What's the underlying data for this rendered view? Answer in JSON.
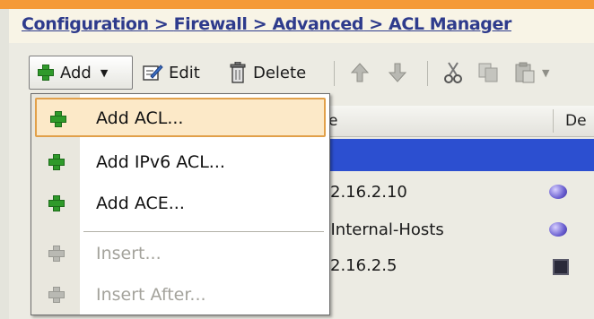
{
  "breadcrumb": {
    "configuration": "Configuration",
    "sep1": " > ",
    "firewall": "Firewall",
    "sep2": " > ",
    "advanced": "Advanced",
    "sep3": " > ",
    "acl_manager": "ACL Manager"
  },
  "toolbar": {
    "add_label": "Add",
    "edit_label": "Edit",
    "delete_label": "Delete",
    "icons": [
      "add-icon",
      "dropdown-arrow-icon",
      "edit-icon",
      "delete-trash-icon",
      "move-up-icon",
      "move-down-icon",
      "cut-icon",
      "copy-icon",
      "paste-icon"
    ]
  },
  "table": {
    "columns": [
      "e",
      "De"
    ],
    "rows": [
      {
        "text": "",
        "selected": true
      },
      {
        "text": "2.16.2.10",
        "icon": "network-object-icon"
      },
      {
        "text": "-Internal-Hosts",
        "icon": "network-object-icon"
      },
      {
        "text": "2.16.2.5",
        "icon": "host-object-icon"
      }
    ]
  },
  "menu": {
    "items": [
      {
        "label": "Add ACL...",
        "enabled": true,
        "highlighted": true,
        "icon": "add-icon"
      },
      {
        "label": "Add IPv6 ACL...",
        "enabled": true,
        "icon": "add-icon"
      },
      {
        "label": "Add ACE...",
        "enabled": true,
        "icon": "add-icon"
      },
      {
        "label": "Insert...",
        "enabled": false,
        "icon": "insert-icon"
      },
      {
        "label": "Insert After...",
        "enabled": false,
        "icon": "insert-after-icon"
      }
    ]
  },
  "colors": {
    "accent_orange": "#f59a38",
    "link_blue": "#2e3b8c",
    "selection_blue": "#2c4fd0",
    "menu_highlight": "#fce9c8",
    "menu_highlight_border": "#e1a04a",
    "add_green": "#2f9a2a"
  }
}
